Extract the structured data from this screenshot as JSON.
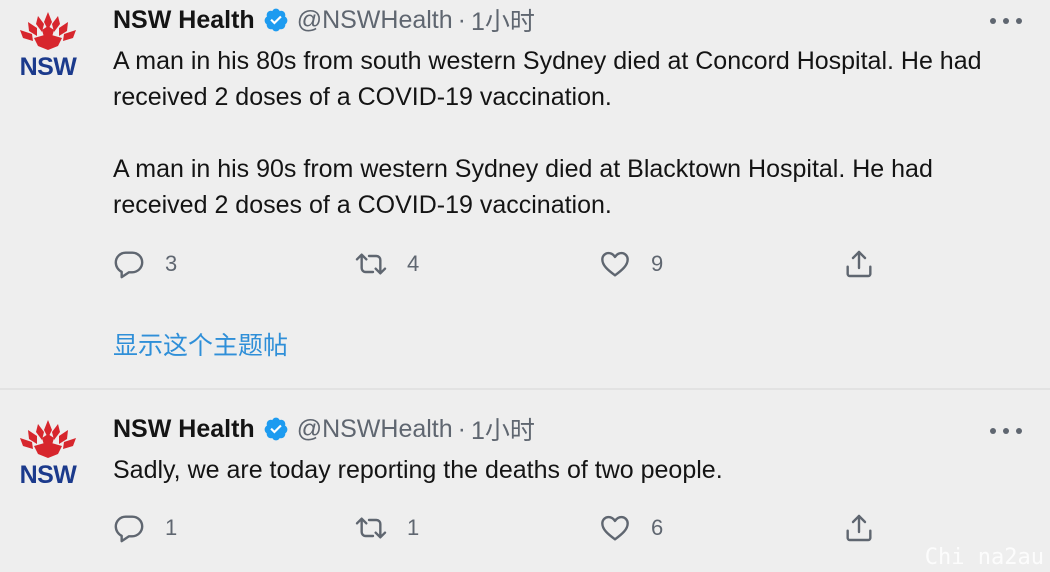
{
  "tweets": [
    {
      "author": {
        "display_name": "NSW Health",
        "handle": "@NSWHealth",
        "separator": "·",
        "time": "1小时",
        "avatar_text": "NSW",
        "verified_icon": "verified-badge-icon"
      },
      "paragraphs": [
        "A man in his 80s from south western Sydney died at Concord Hospital. He had received 2 doses of a COVID-19 vaccination.",
        "A man in his 90s from western Sydney died at Blacktown Hospital. He had received 2 doses of a COVID-19 vaccination."
      ],
      "actions": {
        "reply_count": "3",
        "retweet_count": "4",
        "like_count": "9"
      },
      "show_thread_label": "显示这个主题帖"
    },
    {
      "author": {
        "display_name": "NSW Health",
        "handle": "@NSWHealth",
        "separator": "·",
        "time": "1小时",
        "avatar_text": "NSW",
        "verified_icon": "verified-badge-icon"
      },
      "paragraphs": [
        "Sadly, we are today reporting the deaths of two people."
      ],
      "actions": {
        "reply_count": "1",
        "retweet_count": "1",
        "like_count": "6"
      }
    }
  ],
  "watermark": "Chi na2au",
  "colors": {
    "background": "#eeeeee",
    "text": "#141414",
    "secondary": "#5f6670",
    "link": "#2f8fd8",
    "verified": "#1d9bf0",
    "waratah_red": "#d7262d",
    "nsw_blue": "#1b3a8c"
  }
}
